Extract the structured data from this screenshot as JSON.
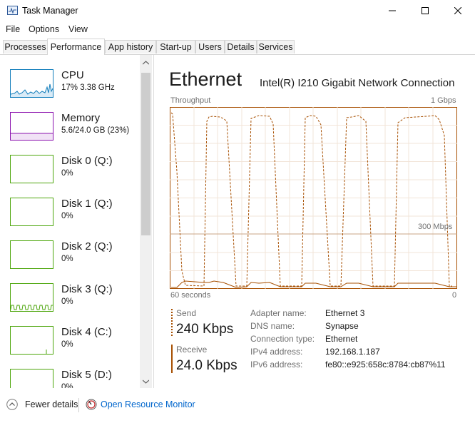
{
  "window": {
    "title": "Task Manager"
  },
  "menu": [
    "File",
    "Options",
    "View"
  ],
  "tabs": [
    "Processes",
    "Performance",
    "App history",
    "Start-up",
    "Users",
    "Details",
    "Services"
  ],
  "active_tab": "Performance",
  "resources": [
    {
      "name": "CPU",
      "sub": "17%  3.38 GHz",
      "color": "#117dbb"
    },
    {
      "name": "Memory",
      "sub": "5.6/24.0 GB (23%)",
      "color": "#8b12ae"
    },
    {
      "name": "Disk 0 (Q:)",
      "sub": "0%",
      "color": "#4da60c"
    },
    {
      "name": "Disk 1 (Q:)",
      "sub": "0%",
      "color": "#4da60c"
    },
    {
      "name": "Disk 2 (Q:)",
      "sub": "0%",
      "color": "#4da60c"
    },
    {
      "name": "Disk 3 (Q:)",
      "sub": "0%",
      "color": "#4da60c"
    },
    {
      "name": "Disk 4 (C:)",
      "sub": "0%",
      "color": "#4da60c"
    },
    {
      "name": "Disk 5 (D:)",
      "sub": "0%",
      "color": "#4da60c"
    }
  ],
  "detail": {
    "heading": "Ethernet",
    "adapter": "Intel(R) I210 Gigabit Network Connection",
    "throughput_label": "Throughput",
    "max_label": "1 Gbps",
    "mid_label": "300 Mbps",
    "time_label": "60 seconds",
    "zero_label": "0",
    "accent": "#a74f01",
    "send": {
      "label": "Send",
      "value": "240 Kbps"
    },
    "receive": {
      "label": "Receive",
      "value": "24.0 Kbps"
    },
    "info": [
      {
        "key": "Adapter name:",
        "value": "Ethernet 3"
      },
      {
        "key": "DNS name:",
        "value": "Synapse"
      },
      {
        "key": "Connection type:",
        "value": "Ethernet"
      },
      {
        "key": "IPv4 address:",
        "value": "192.168.1.187"
      },
      {
        "key": "IPv6 address:",
        "value": "fe80::e925:658c:8784:cb87%11"
      }
    ]
  },
  "footer": {
    "fewer": "Fewer details",
    "monitor": "Open Resource Monitor"
  }
}
